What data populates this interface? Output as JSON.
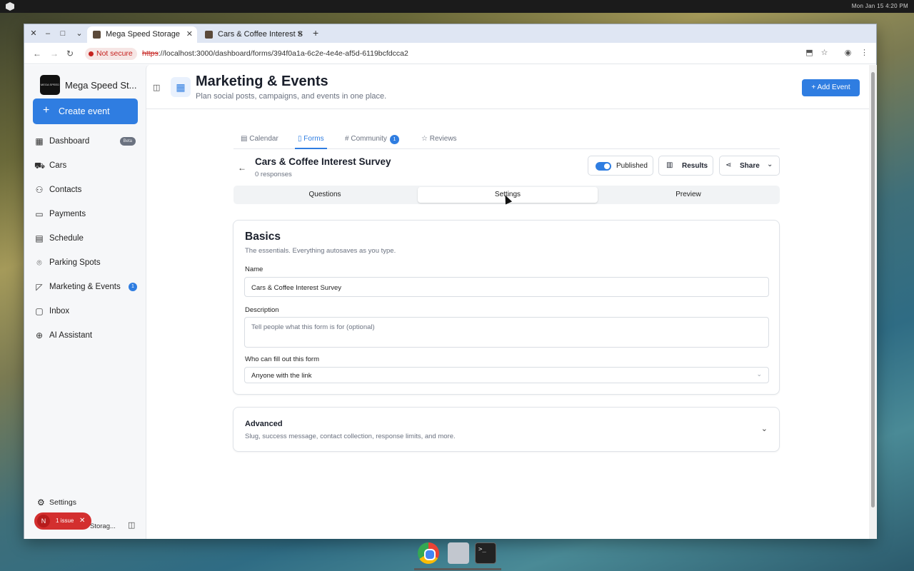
{
  "desktop": {
    "clock": "Mon Jan 15   4:20 PM"
  },
  "browser": {
    "tabs": [
      {
        "title": "Mega Speed Storage",
        "active": true
      },
      {
        "title": "Cars & Coffee Interest S",
        "active": false
      }
    ],
    "security": "Not secure",
    "url_scheme": "https",
    "url_rest": "://localhost:3000/dashboard/forms/394f0a1a-6c2e-4e4e-af5d-6119bcfdcca2"
  },
  "sidebar": {
    "brand_name": "Mega Speed St...",
    "brand_logo_text": "MEGA SPEED STORAGE",
    "create_label": "Create event",
    "items": [
      {
        "label": "Dashboard",
        "icon": "grid-icon",
        "badge": "Beta"
      },
      {
        "label": "Cars",
        "icon": "car-icon"
      },
      {
        "label": "Contacts",
        "icon": "users-icon"
      },
      {
        "label": "Payments",
        "icon": "card-icon"
      },
      {
        "label": "Schedule",
        "icon": "calendar-icon"
      },
      {
        "label": "Parking Spots",
        "icon": "pin-icon"
      },
      {
        "label": "Marketing & Events",
        "icon": "megaphone-icon",
        "count": "1"
      },
      {
        "label": "Inbox",
        "icon": "inbox-icon"
      },
      {
        "label": "AI Assistant",
        "icon": "ai-icon"
      }
    ],
    "settings_label": "Settings",
    "issue_initial": "N",
    "issue_label": "1 issue",
    "footer_label": "Storag..."
  },
  "header": {
    "title": "Marketing & Events",
    "subtitle": "Plan social posts, campaigns, and events in one place.",
    "add_event": "Add Event"
  },
  "section_tabs": [
    {
      "label": "Calendar",
      "icon": "calendar-icon"
    },
    {
      "label": "Forms",
      "icon": "clipboard-icon",
      "active": true
    },
    {
      "label": "Community",
      "icon": "hash-icon",
      "count": "1"
    },
    {
      "label": "Reviews",
      "icon": "star-icon"
    }
  ],
  "form": {
    "title": "Cars & Coffee Interest Survey",
    "responses": "0 responses",
    "published_label": "Published",
    "published": true,
    "results_label": "Results",
    "share_label": "Share"
  },
  "segments": [
    {
      "label": "Questions"
    },
    {
      "label": "Settings",
      "active": true
    },
    {
      "label": "Preview"
    }
  ],
  "basics": {
    "title": "Basics",
    "description": "The essentials. Everything autosaves as you type.",
    "name_label": "Name",
    "name_value": "Cars & Coffee Interest Survey",
    "description_label": "Description",
    "description_placeholder": "Tell people what this form is for (optional)",
    "who_label": "Who can fill out this form",
    "who_value": "Anyone with the link"
  },
  "advanced": {
    "title": "Advanced",
    "description": "Slug, success message, contact collection, response limits, and more."
  },
  "colors": {
    "accent": "#2f7de1",
    "danger": "#d32f2f"
  }
}
